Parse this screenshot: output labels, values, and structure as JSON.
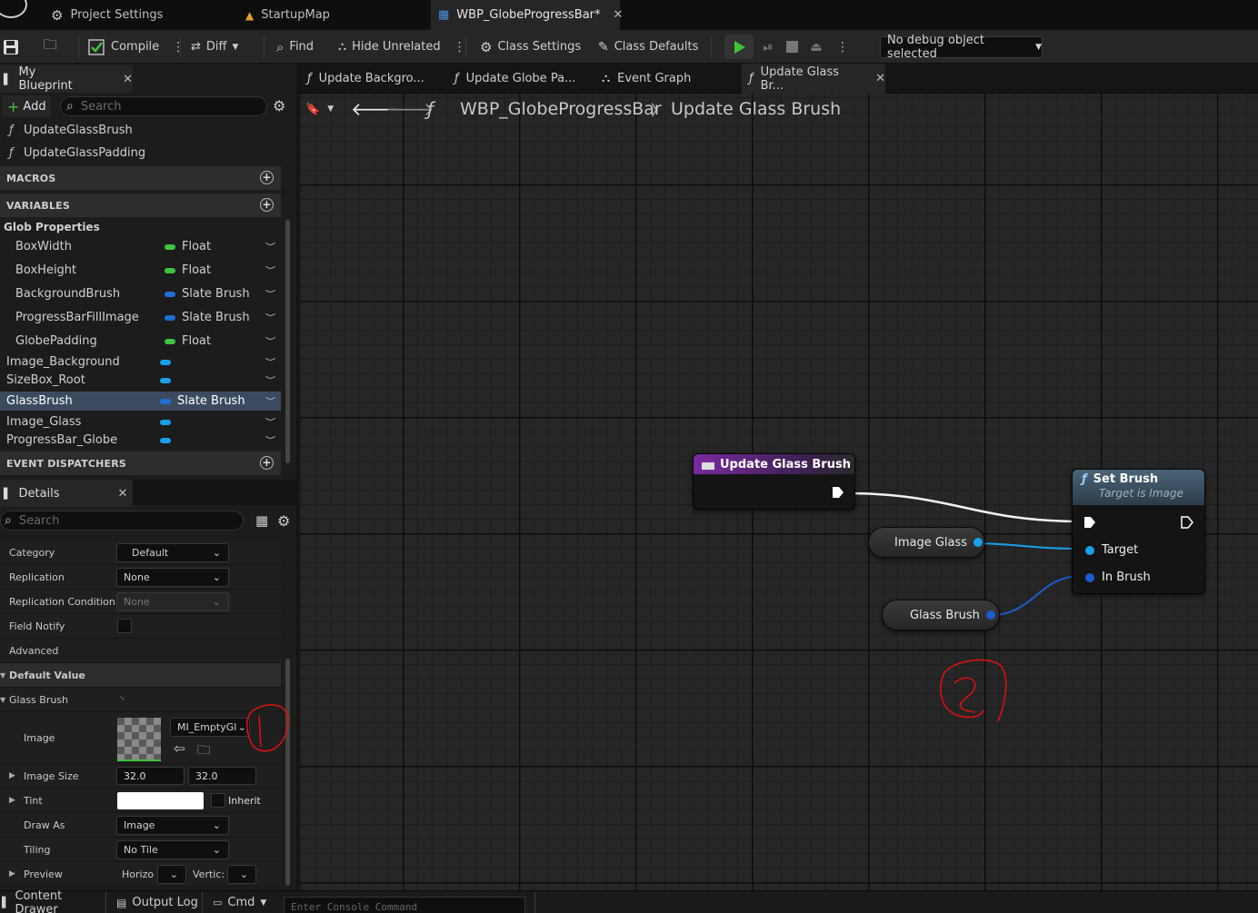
{
  "top_tabs": [
    {
      "label": "Project Settings"
    },
    {
      "label": "StartupMap"
    },
    {
      "label": "WBP_GlobeProgressBar*"
    }
  ],
  "toolbar": {
    "compile": "Compile",
    "diff": "Diff",
    "find": "Find",
    "hide_unrelated": "Hide Unrelated",
    "class_settings": "Class Settings",
    "class_defaults": "Class Defaults",
    "debug_object": "No debug object selected"
  },
  "my_blueprint": {
    "tab_label": "My Blueprint",
    "add_label": "Add",
    "search_placeholder": "Search",
    "functions": [
      "UpdateGlassBrush",
      "UpdateGlassPadding"
    ],
    "macros_header": "MACROS",
    "variables_header": "VARIABLES",
    "category": "Glob Properties",
    "variables": [
      {
        "name": "BoxWidth",
        "type": "Float",
        "color": "#3ec43e"
      },
      {
        "name": "BoxHeight",
        "type": "Float",
        "color": "#3ec43e"
      },
      {
        "name": "BackgroundBrush",
        "type": "Slate Brush",
        "color": "#1f6fd6"
      },
      {
        "name": "ProgressBarFillImage",
        "type": "Slate Brush",
        "color": "#1f6fd6"
      },
      {
        "name": "GlobePadding",
        "type": "Float",
        "color": "#3ec43e"
      },
      {
        "name": "Image_Background",
        "type": "",
        "color": "#19a0ea"
      },
      {
        "name": "SizeBox_Root",
        "type": "",
        "color": "#19a0ea"
      },
      {
        "name": "GlassBrush",
        "type": "Slate Brush",
        "color": "#1f6fd6"
      },
      {
        "name": "Image_Glass",
        "type": "",
        "color": "#19a0ea"
      },
      {
        "name": "ProgressBar_Globe",
        "type": "",
        "color": "#19a0ea"
      }
    ],
    "dispatchers_header": "EVENT DISPATCHERS"
  },
  "details": {
    "tab_label": "Details",
    "search_placeholder": "Search",
    "category_label": "Category",
    "category_value": "Default",
    "replication_label": "Replication",
    "replication_value": "None",
    "replication_condition_label": "Replication Condition",
    "replication_condition_value": "None",
    "field_notify_label": "Field Notify",
    "advanced_label": "Advanced",
    "default_value_label": "Default Value",
    "glass_brush_label": "Glass Brush",
    "image_label": "Image",
    "image_value": "MI_EmptyGl",
    "image_size_label": "Image Size",
    "image_size_x": "32.0",
    "image_size_y": "32.0",
    "tint_label": "Tint",
    "inherit_label": "Inherit",
    "draw_as_label": "Draw As",
    "draw_as_value": "Image",
    "tiling_label": "Tiling",
    "tiling_value": "No Tile",
    "preview_label": "Preview",
    "preview_h": "Horizo",
    "preview_v": "Vertic:"
  },
  "graph_tabs": [
    {
      "label": "Update Backgro..."
    },
    {
      "label": "Update Globe Pa..."
    },
    {
      "label": "Event Graph"
    },
    {
      "label": "Update Glass Br..."
    }
  ],
  "breadcrumb": {
    "blueprint": "WBP_GlobeProgressBar",
    "function": "Update Glass Brush"
  },
  "graph": {
    "entry_node_title": "Update Glass Brush",
    "set_node_title": "Set Brush",
    "set_node_subtitle": "Target is Image",
    "pin_target": "Target",
    "pin_in_brush": "In Brush",
    "var_image_glass": "Image Glass",
    "var_glass_brush": "Glass Brush",
    "annotation_2": "2",
    "annotation_1": "1"
  },
  "bottom": {
    "content_drawer": "Content Drawer",
    "output_log": "Output Log",
    "cmd": "Cmd",
    "console_placeholder": "Enter Console Command"
  }
}
